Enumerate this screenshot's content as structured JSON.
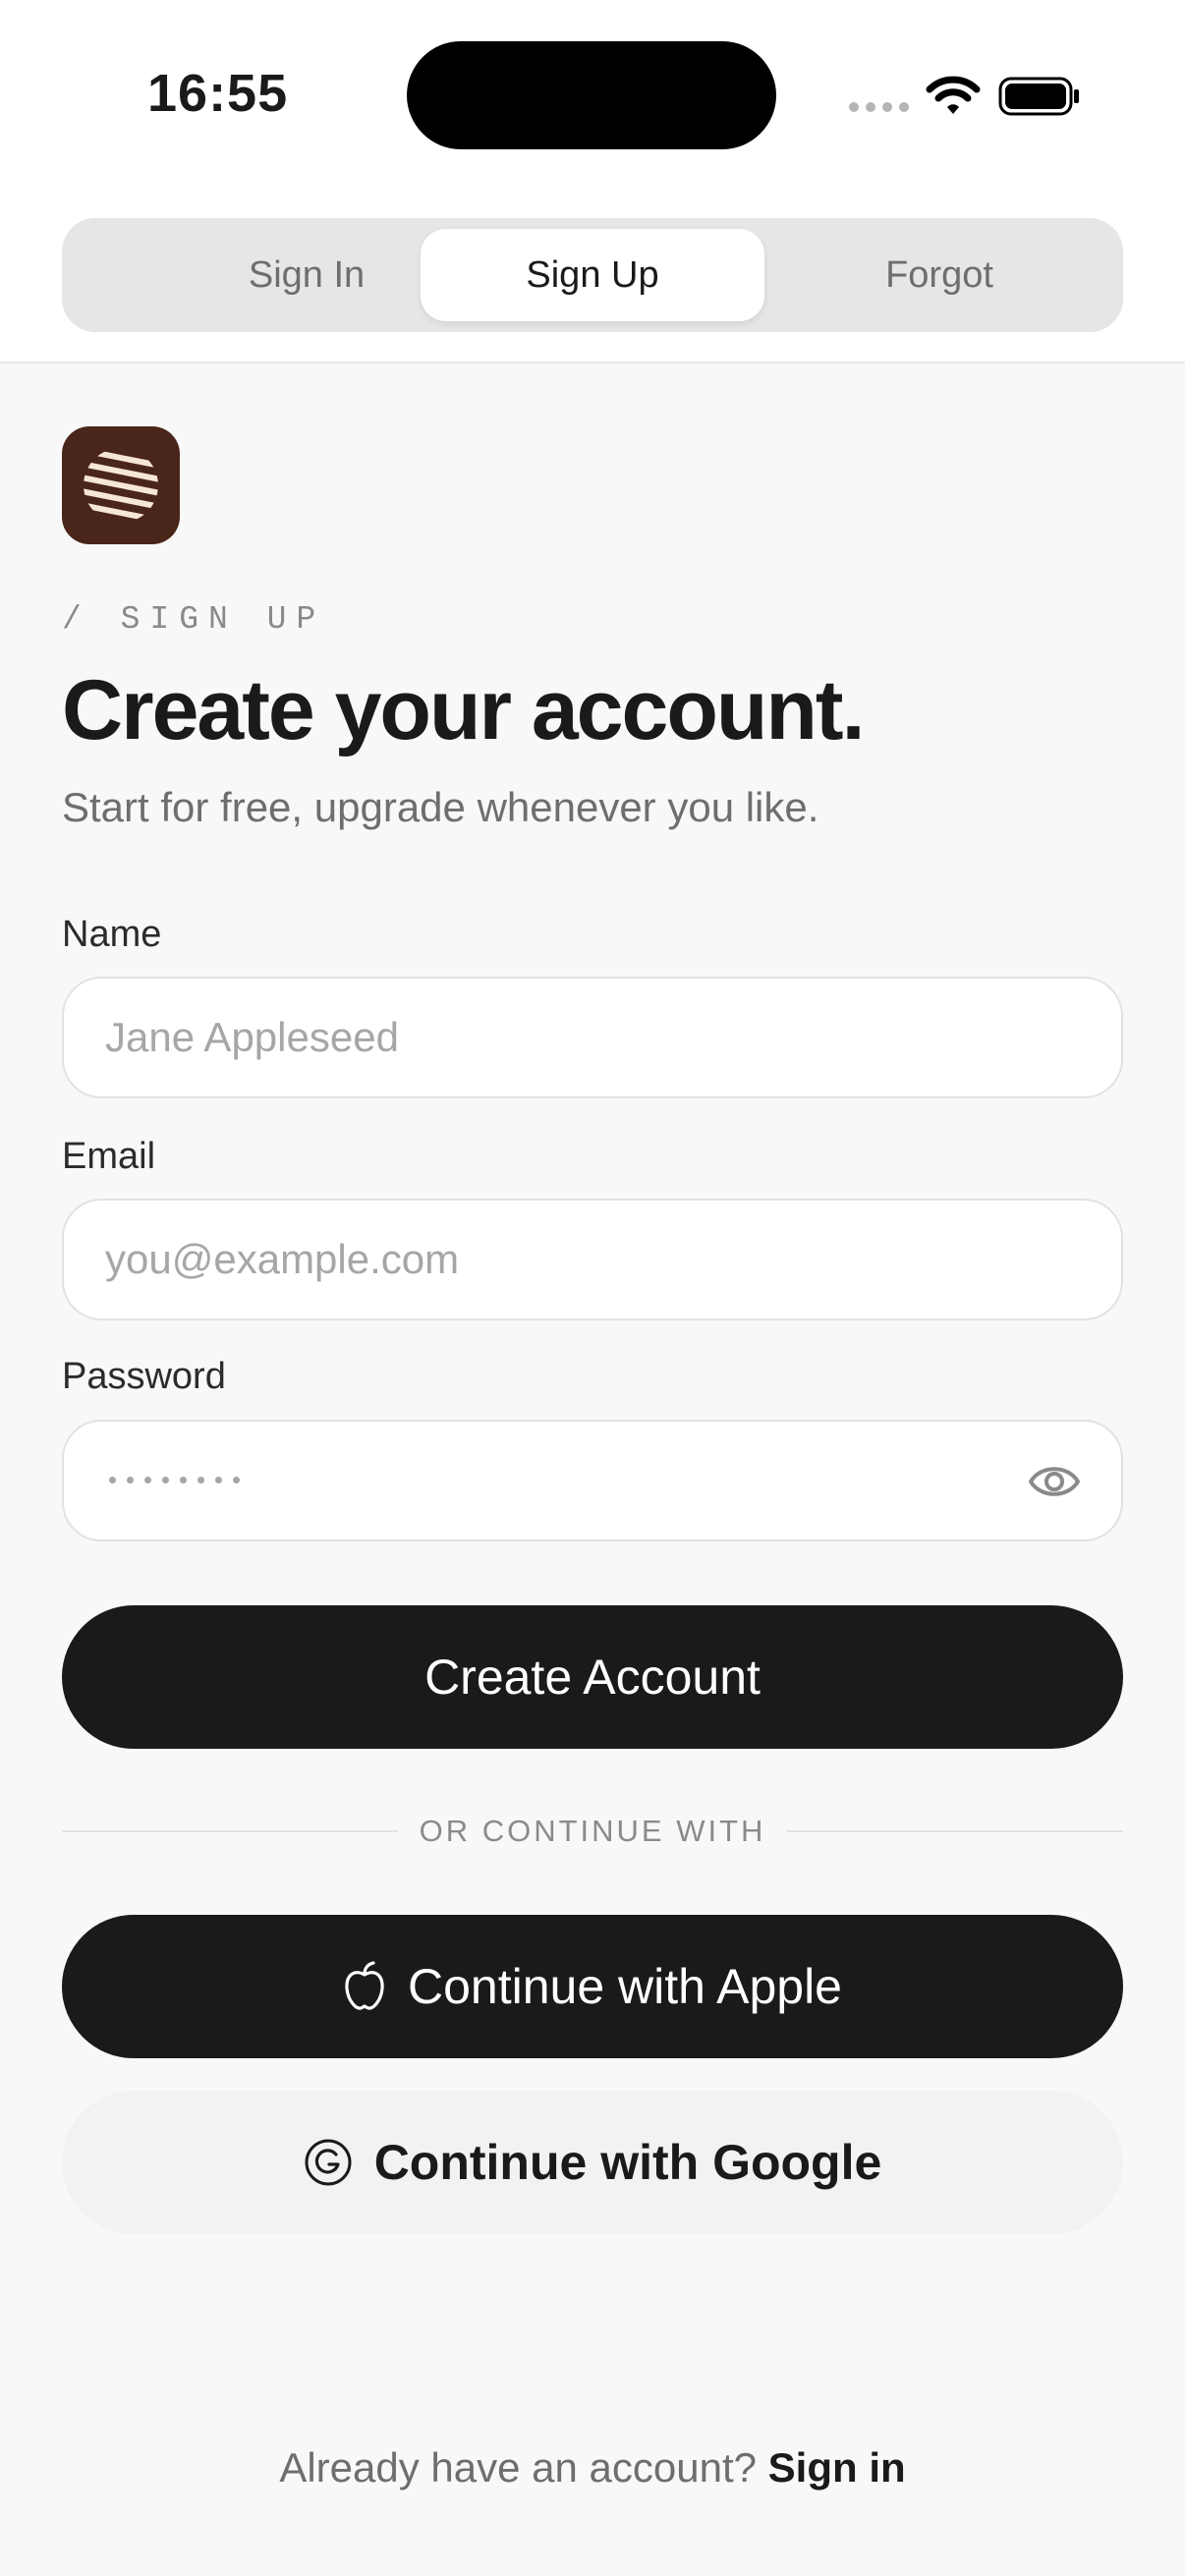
{
  "status_bar": {
    "time": "16:55"
  },
  "tabs": [
    {
      "label": "Sign In",
      "active": false
    },
    {
      "label": "Sign Up",
      "active": true
    },
    {
      "label": "Forgot",
      "active": false
    }
  ],
  "page": {
    "eyebrow": "/ SIGN UP",
    "title": "Create your account.",
    "subtitle": "Start for free, upgrade whenever you like."
  },
  "form": {
    "name_label": "Name",
    "name_placeholder": "Jane Appleseed",
    "email_label": "Email",
    "email_placeholder": "you@example.com",
    "password_label": "Password",
    "submit_label": "Create Account"
  },
  "divider": "OR CONTINUE WITH",
  "social": {
    "apple_label": "Continue with Apple",
    "google_label": "Continue with Google"
  },
  "footer": {
    "prompt": "Already have an account?",
    "link": "Sign in"
  },
  "colors": {
    "primary": "#1a1a1a",
    "brand_logo": "#4a251a",
    "background": "#f8f8f8"
  },
  "icons": [
    "wifi-icon",
    "battery-icon",
    "app-logo-icon",
    "eye-icon",
    "apple-icon",
    "google-icon"
  ]
}
